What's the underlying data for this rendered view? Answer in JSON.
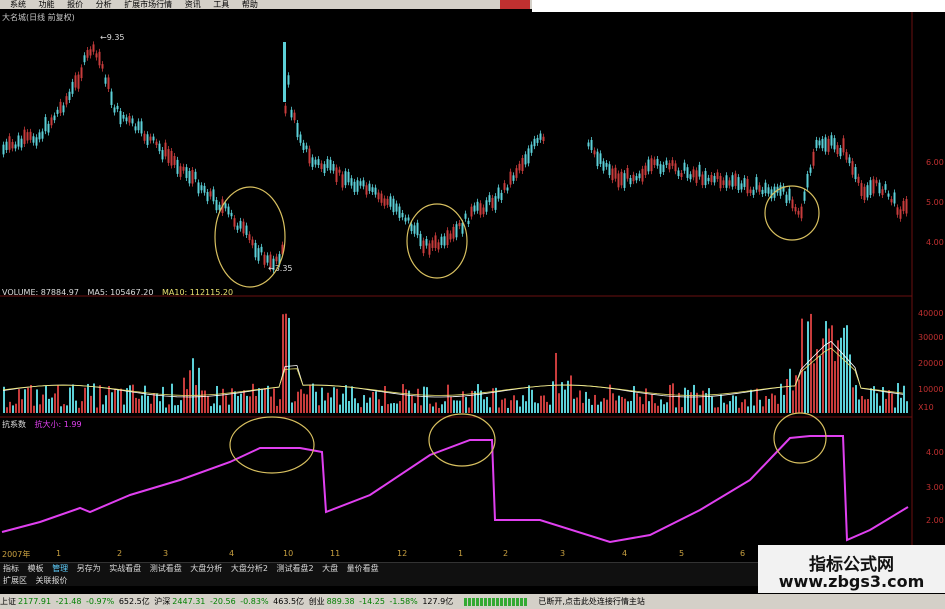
{
  "menu": [
    "系统",
    "功能",
    "报价",
    "分析",
    "扩展市场行情",
    "资讯",
    "工具",
    "帮助"
  ],
  "stock_title": "大名城(日线 前复权)",
  "price_high_label": "9.35",
  "price_low_label": "3.35",
  "price_axis": [
    "6.00",
    "5.00",
    "4.00"
  ],
  "volume_info": {
    "volume": "VOLUME: 87884.97",
    "ma5": "MA5: 105467.20",
    "ma10": "MA10: 112115.20"
  },
  "volume_axis": [
    "40000",
    "30000",
    "20000",
    "10000",
    "X10"
  ],
  "indicator_info": {
    "name": "抗系数",
    "value": "抗大小: 1.99"
  },
  "indicator_axis": [
    "4.00",
    "3.00",
    "2.00"
  ],
  "time_axis": [
    "2007年",
    "1",
    "2",
    "3",
    "4",
    "10",
    "11",
    "12",
    "1",
    "2",
    "3",
    "4",
    "5",
    "6"
  ],
  "tabs": [
    "指标",
    "模板",
    "管理",
    "另存为",
    "实战看盘",
    "测试看盘",
    "大盘分析",
    "大盘分析2",
    "测试看盘2",
    "大盘",
    "量价看盘"
  ],
  "tabs2": [
    "扩展区",
    "关联报价"
  ],
  "status": {
    "sh_label": "上证",
    "sh_index": "2177.91",
    "sh_chg": "-21.48",
    "sh_pct": "-0.97%",
    "sh_amt": "652.5亿",
    "sz_label": "沪深",
    "sz_index": "2447.31",
    "sz_chg": "-20.56",
    "sz_pct": "-0.83%",
    "sz_amt": "463.5亿",
    "cy_label": "创业",
    "cy_index": "889.38",
    "cy_chg": "-14.25",
    "cy_pct": "-1.58%",
    "cy_amt": "127.9亿",
    "message": "已断开,点击此处连接行情主站"
  },
  "watermark": {
    "title": "指标公式网",
    "url": "www.zbgs3.com"
  },
  "colors": {
    "up": "#c83c3c",
    "down": "#5cd0d8",
    "indicator": "#e040f0",
    "circle": "#d8c060",
    "ma": "#e8e070"
  }
}
